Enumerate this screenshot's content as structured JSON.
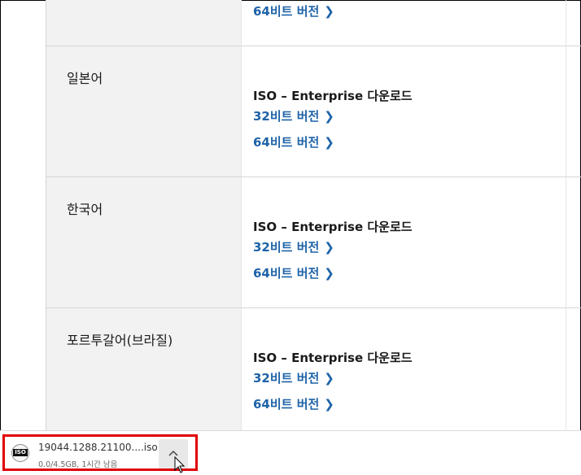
{
  "rows": [
    {
      "language": "",
      "title": "",
      "link32": "",
      "link64": "64비트 버전"
    },
    {
      "language": "일본어",
      "title": "ISO – Enterprise 다운로드",
      "link32": "32비트 버전",
      "link64": "64비트 버전"
    },
    {
      "language": "한국어",
      "title": "ISO – Enterprise 다운로드",
      "link32": "32비트 버전",
      "link64": "64비트 버전"
    },
    {
      "language": "포르투갈어(브라질)",
      "title": "ISO – Enterprise 다운로드",
      "link32": "32비트 버전",
      "link64": "64비트 버전"
    }
  ],
  "download_bar": {
    "file_name": "19044.1288.21100....iso",
    "status": "0.0/4.5GB, 1시간 남음",
    "icon_label": "ISO"
  },
  "colors": {
    "link": "#1e63a8",
    "highlight": "#e00000",
    "lang_cell_bg": "#f2f2f2"
  }
}
